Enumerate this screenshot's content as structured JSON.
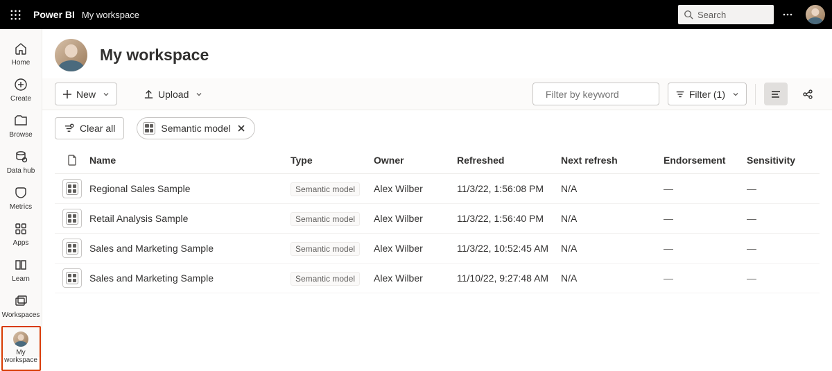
{
  "top": {
    "brand": "Power BI",
    "workspace": "My workspace",
    "search_placeholder": "Search"
  },
  "leftnav": [
    {
      "label": "Home"
    },
    {
      "label": "Create"
    },
    {
      "label": "Browse"
    },
    {
      "label": "Data hub"
    },
    {
      "label": "Metrics"
    },
    {
      "label": "Apps"
    },
    {
      "label": "Learn"
    },
    {
      "label": "Workspaces"
    },
    {
      "label": "My workspace"
    }
  ],
  "header": {
    "title": "My workspace"
  },
  "toolbar": {
    "new_label": "New",
    "upload_label": "Upload",
    "filter_placeholder": "Filter by keyword",
    "filter_btn": "Filter (1)"
  },
  "chips": {
    "clear_label": "Clear all",
    "chip_label": "Semantic model"
  },
  "columns": {
    "name": "Name",
    "type": "Type",
    "owner": "Owner",
    "refreshed": "Refreshed",
    "next": "Next refresh",
    "endorsement": "Endorsement",
    "sensitivity": "Sensitivity"
  },
  "rows": [
    {
      "name": "Regional Sales Sample",
      "type": "Semantic model",
      "owner": "Alex Wilber",
      "refreshed": "11/3/22, 1:56:08 PM",
      "next": "N/A",
      "end": "—",
      "sen": "—"
    },
    {
      "name": "Retail Analysis Sample",
      "type": "Semantic model",
      "owner": "Alex Wilber",
      "refreshed": "11/3/22, 1:56:40 PM",
      "next": "N/A",
      "end": "—",
      "sen": "—"
    },
    {
      "name": "Sales and Marketing Sample",
      "type": "Semantic model",
      "owner": "Alex Wilber",
      "refreshed": "11/3/22, 10:52:45 AM",
      "next": "N/A",
      "end": "—",
      "sen": "—"
    },
    {
      "name": "Sales and Marketing Sample",
      "type": "Semantic model",
      "owner": "Alex Wilber",
      "refreshed": "11/10/22, 9:27:48 AM",
      "next": "N/A",
      "end": "—",
      "sen": "—"
    }
  ]
}
